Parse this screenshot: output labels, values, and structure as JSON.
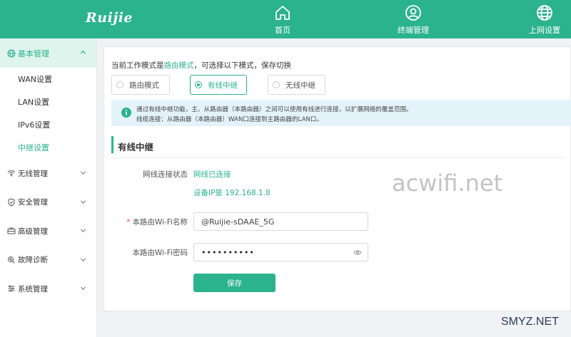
{
  "header": {
    "logo": "Ruijie",
    "nav": [
      {
        "label": "首页",
        "icon": "home-icon"
      },
      {
        "label": "终端管理",
        "icon": "user-icon"
      },
      {
        "label": "上网设置",
        "icon": "globe-icon"
      }
    ]
  },
  "sidebar": {
    "group": {
      "label": "基本管理",
      "icon": "globe-icon",
      "expanded": true
    },
    "sub_items": [
      {
        "label": "WAN设置",
        "active": false
      },
      {
        "label": "LAN设置",
        "active": false
      },
      {
        "label": "IPv6设置",
        "active": false
      },
      {
        "label": "中继设置",
        "active": true
      }
    ],
    "items": [
      {
        "label": "无线管理",
        "icon": "wifi-icon"
      },
      {
        "label": "安全管理",
        "icon": "shield-icon"
      },
      {
        "label": "高级管理",
        "icon": "toolbox-icon"
      },
      {
        "label": "故障诊断",
        "icon": "diagnose-icon"
      },
      {
        "label": "系统管理",
        "icon": "sliders-icon"
      }
    ]
  },
  "main": {
    "mode_prefix": "当前工作模式是",
    "mode_current": "路由模式",
    "mode_suffix": "，可选择以下模式，保存切换",
    "modes": [
      {
        "label": "路由模式",
        "selected": false
      },
      {
        "label": "有线中继",
        "selected": true
      },
      {
        "label": "无线中继",
        "selected": false
      }
    ],
    "info_line1": "通过有线中继功能，主、从路由器（本路由器）之间可以使用有线进行连接，以扩展网络的覆盖范围。",
    "info_line2": "线缆连接：从路由器（本路由器）WAN口连接到主路由器的LAN口。",
    "section_title": "有线中继",
    "status_label": "网线连接状态",
    "status_value": "网线已连接",
    "device_ip": "设备IP是 192.168.1.8",
    "wifi_name_label": "本路由Wi-Fi名称",
    "wifi_name_value": "@Ruijie-sDAAE_5G",
    "wifi_pwd_label": "本路由Wi-Fi密码",
    "wifi_pwd_value": "••••••••••",
    "save_label": "保存"
  },
  "watermarks": {
    "site1": "acwifi.net",
    "site2": "SMYZ.NET"
  },
  "colors": {
    "accent": "#2bb38d",
    "info_bg": "#e4f3fa"
  }
}
